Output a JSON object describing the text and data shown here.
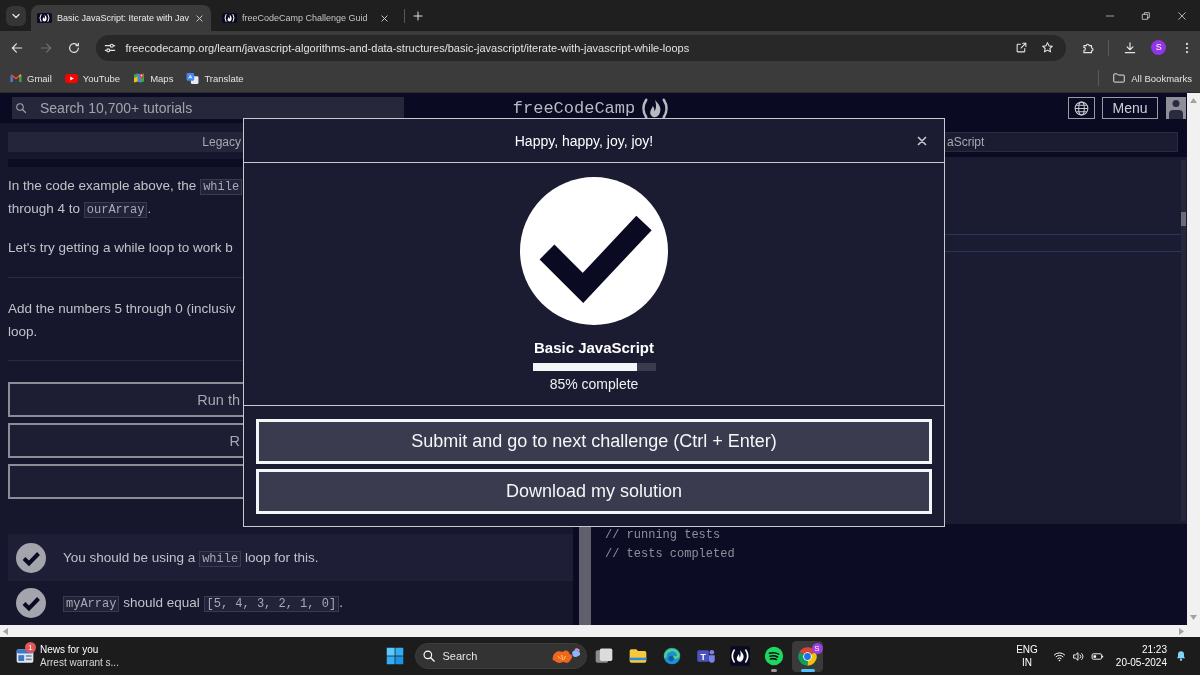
{
  "browser": {
    "tabs": [
      {
        "title": "Basic JavaScript: Iterate with Jav",
        "selected": true
      },
      {
        "title": "freeCodeCamp Challenge Guid",
        "selected": false
      }
    ],
    "forward_disabled": true,
    "url": "freecodecamp.org/learn/javascript-algorithms-and-data-structures/basic-javascript/iterate-with-javascript-while-loops",
    "bookmarked": false,
    "profile_initial": "S",
    "bookmarks": [
      {
        "label": "Gmail",
        "kind": "mail"
      },
      {
        "label": "YouTube",
        "kind": "video"
      },
      {
        "label": "Maps",
        "kind": "map"
      },
      {
        "label": "Translate",
        "kind": "translate"
      }
    ],
    "all_bookmarks": "All Bookmarks"
  },
  "site_nav": {
    "search": {
      "placeholder": "Search 10,700+ tutorials"
    },
    "logo": "freeCodeCamp",
    "menu": "Menu"
  },
  "instructions": {
    "breadcrumb": "Legacy",
    "sections": [
      {
        "paragraphs": [
          {
            "lines": [
              [
                {
                  "kind": "text",
                  "text": "In the code example above, the "
                },
                {
                  "kind": "code",
                  "text": "while"
                }
              ],
              [
                {
                  "kind": "text",
                  "text": "through 4 to "
                },
                {
                  "kind": "code",
                  "text": "ourArray"
                },
                {
                  "kind": "text",
                  "text": "."
                }
              ]
            ]
          },
          {
            "lines": [
              [
                {
                  "kind": "text",
                  "text": "Let's try getting a while loop to work b"
                }
              ]
            ]
          }
        ]
      },
      {
        "paragraphs": [
          {
            "lines": [
              [
                {
                  "kind": "text",
                  "text": "Add the numbers 5 through 0 (inclusiv"
                }
              ],
              [
                {
                  "kind": "text",
                  "text": "loop."
                }
              ]
            ]
          }
        ]
      }
    ],
    "buttons": [
      {
        "kind": "labeled",
        "label": "Run th"
      },
      {
        "kind": "labeled",
        "label": "R"
      },
      {
        "kind": "blank"
      }
    ],
    "tests": [
      {
        "passed": true,
        "parts": [
          {
            "kind": "text",
            "text": "You should be using a "
          },
          {
            "kind": "code",
            "text": "while"
          },
          {
            "kind": "text",
            "text": " loop for this."
          }
        ]
      },
      {
        "passed": true,
        "parts": [
          {
            "kind": "code",
            "text": "myArray"
          },
          {
            "kind": "text",
            "text": " should equal "
          },
          {
            "kind": "code",
            "text": "[5, 4, 3, 2, 1, 0]"
          },
          {
            "kind": "text",
            "text": "."
          }
        ]
      }
    ]
  },
  "editor": {
    "breadcrumb": "aScript"
  },
  "console": {
    "lines": [
      "// running tests",
      "// tests completed"
    ]
  },
  "dialog": {
    "title": "Happy, happy, joy, joy!",
    "block": "Basic JavaScript",
    "level": 0.85,
    "progress_label": "85% complete",
    "buttons": [
      "Submit and go to next challenge (Ctrl + Enter)",
      "Download my solution"
    ]
  },
  "taskbar": {
    "news": {
      "badge": "1",
      "title": "News for you",
      "headline": "Arrest warrant s..."
    },
    "search": {
      "placeholder": "Search"
    },
    "apps": [
      {
        "kind": "taskview",
        "open": false,
        "active": false
      },
      {
        "kind": "folder",
        "open": false,
        "active": false
      },
      {
        "kind": "swirl",
        "open": false,
        "active": false
      },
      {
        "kind": "team",
        "glyph": "T",
        "open": false,
        "active": false
      },
      {
        "kind": "flame",
        "open": false,
        "active": false
      },
      {
        "kind": "waves",
        "open": true,
        "active": false
      },
      {
        "kind": "ring",
        "badge": "S",
        "open": true,
        "active": true
      }
    ],
    "language": {
      "input": "ENG",
      "region": "IN"
    },
    "clock": {
      "time": "21:23",
      "date": "20-05-2024"
    }
  }
}
